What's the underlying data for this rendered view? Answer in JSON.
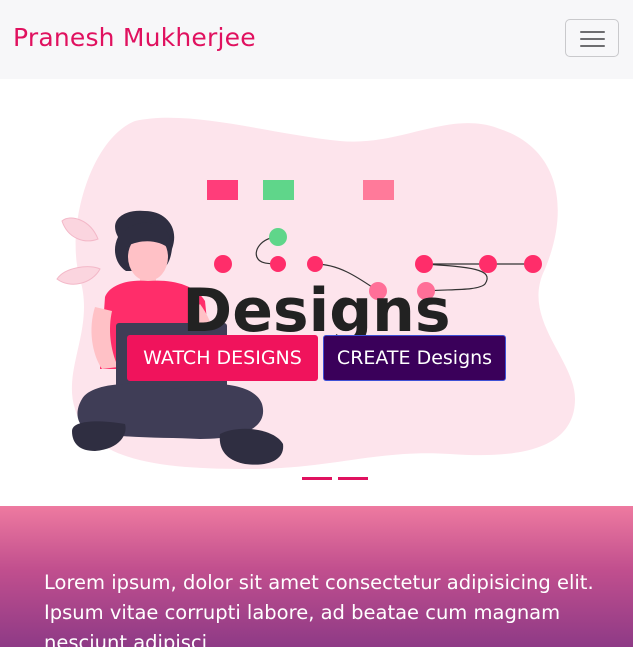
{
  "navbar": {
    "brand": "Pranesh Mukherjee",
    "toggler_icon": "hamburger-menu-icon"
  },
  "hero": {
    "title": "Designs",
    "buttons": {
      "watch": "WATCH DESIGNS",
      "create": "CREATE Designs"
    },
    "indicators": 2,
    "colors": {
      "accent": "#e0115f",
      "watch_button": "#f0135c",
      "create_button": "#3a005a",
      "blob": "#fde4ec"
    }
  },
  "section": {
    "text": "Lorem ipsum, dolor sit amet consectetur adipisicing elit. Ipsum vitae corrupti labore, ad beatae cum magnam nesciunt adipisci"
  }
}
